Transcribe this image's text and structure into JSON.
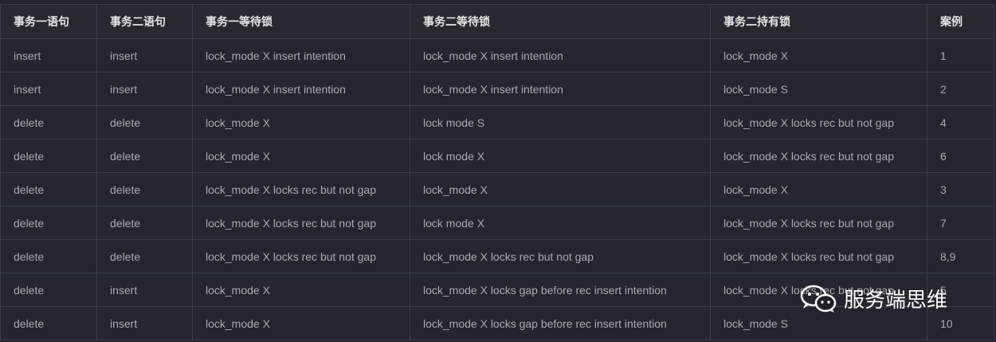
{
  "table": {
    "headers": [
      "事务一语句",
      "事务二语句",
      "事务一等待锁",
      "事务二等待锁",
      "事务二持有锁",
      "案例"
    ],
    "rows": [
      [
        "insert",
        "insert",
        "lock_mode X insert intention",
        "lock_mode X insert intention",
        "lock_mode X",
        "1"
      ],
      [
        "insert",
        "insert",
        "lock_mode X insert intention",
        "lock_mode X insert intention",
        "lock_mode S",
        "2"
      ],
      [
        "delete",
        "delete",
        "lock_mode X",
        "lock mode S",
        "lock_mode X locks rec but not gap",
        "4"
      ],
      [
        "delete",
        "delete",
        "lock_mode X",
        "lock mode X",
        "lock_mode X locks rec but not gap",
        "6"
      ],
      [
        "delete",
        "delete",
        "lock_mode X locks rec but not gap",
        "lock_mode X",
        "lock_mode X",
        "3"
      ],
      [
        "delete",
        "delete",
        "lock_mode X locks rec but not gap",
        "lock mode X",
        "lock_mode X locks rec but not gap",
        "7"
      ],
      [
        "delete",
        "delete",
        "lock_mode X locks rec but not gap",
        "lock_mode X locks rec but not gap",
        "lock_mode X locks rec but not gap",
        "8,9"
      ],
      [
        "delete",
        "insert",
        "lock_mode X",
        "lock_mode X locks gap before rec insert intention",
        "lock_mode X locks rec but not gap",
        "5"
      ],
      [
        "delete",
        "insert",
        "lock_mode X",
        "lock_mode X locks gap before rec insert intention",
        "lock_mode S",
        "10"
      ]
    ]
  },
  "watermark": {
    "icon": "wechat-icon",
    "text": "服务端思维"
  },
  "colors": {
    "background": "#1f2229",
    "header_text": "#e6e6e6",
    "cell_text": "#a8abb2",
    "border": "#3a3e47"
  }
}
